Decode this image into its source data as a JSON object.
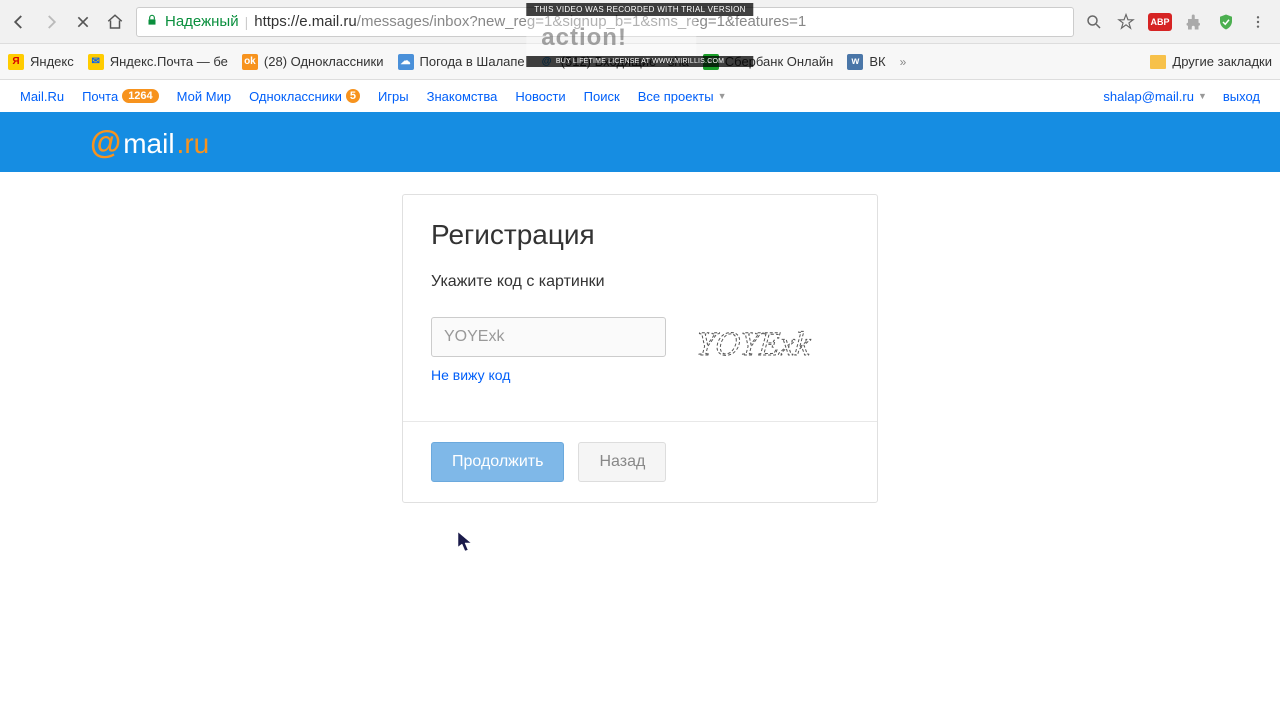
{
  "watermark": {
    "top": "THIS VIDEO WAS RECORDED WITH TRIAL VERSION",
    "bottom": "BUY LIFETIME LICENSE AT WWW.MIRILLIS.COM"
  },
  "browser": {
    "secure_label": "Надежный",
    "url_host": "https://e.mail.ru",
    "url_rest": "/messages/inbox?new_reg=1&signup_b=1&sms_reg=1&features=1",
    "abp_label": "ABP"
  },
  "bookmarks": [
    {
      "label": "Яндекс"
    },
    {
      "label": "Яндекс.Почта — бе"
    },
    {
      "label": "(28) Одноклассники"
    },
    {
      "label": "Погода в Шалапе"
    },
    {
      "label": "(512) Входящие - sha"
    },
    {
      "label": "Сбербанк Онлайн"
    },
    {
      "label": "ВК"
    }
  ],
  "bookmarks_other": "Другие закладки",
  "portal": {
    "links": [
      {
        "label": "Mail.Ru"
      },
      {
        "label": "Почта",
        "badge": "1264"
      },
      {
        "label": "Мой Мир"
      },
      {
        "label": "Одноклассники",
        "badge_small": "5"
      },
      {
        "label": "Игры"
      },
      {
        "label": "Знакомства"
      },
      {
        "label": "Новости"
      },
      {
        "label": "Поиск"
      },
      {
        "label": "Все проекты"
      }
    ],
    "user": "shalap@mail.ru",
    "logout": "выход"
  },
  "registration": {
    "title": "Регистрация",
    "subtitle": "Укажите код с картинки",
    "captcha_placeholder": "YOYExk",
    "captcha_text": "YOYExk",
    "cant_see": "Не вижу код",
    "continue": "Продолжить",
    "back": "Назад"
  }
}
